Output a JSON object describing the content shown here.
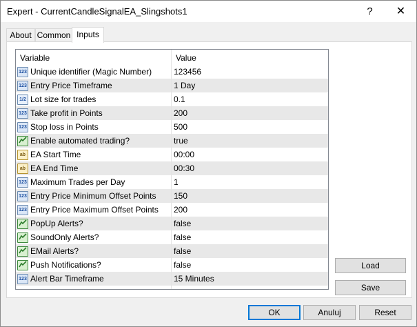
{
  "window": {
    "title": "Expert - CurrentCandleSignalEA_Slingshots1",
    "help_label": "?",
    "close_label": "✕"
  },
  "tabs": [
    {
      "label": "About"
    },
    {
      "label": "Common"
    },
    {
      "label": "Inputs",
      "active": true
    }
  ],
  "grid": {
    "columns": [
      "Variable",
      "Value"
    ],
    "rows": [
      {
        "icon": "int-type-icon",
        "badge": "123",
        "variable": "Unique identifier (Magic Number)",
        "value": "123456"
      },
      {
        "icon": "int-type-icon",
        "badge": "123",
        "variable": "Entry Price Timeframe",
        "value": "1 Day"
      },
      {
        "icon": "double-type-icon",
        "badge": "1/2",
        "variable": "Lot size for trades",
        "value": "0.1"
      },
      {
        "icon": "int-type-icon",
        "badge": "123",
        "variable": "Take profit in Points",
        "value": "200"
      },
      {
        "icon": "int-type-icon",
        "badge": "123",
        "variable": "Stop loss in Points",
        "value": "500"
      },
      {
        "icon": "bool-type-icon",
        "badge": "",
        "variable": "Enable automated trading?",
        "value": "true"
      },
      {
        "icon": "string-type-icon",
        "badge": "ab",
        "variable": "EA Start Time",
        "value": "00:00"
      },
      {
        "icon": "string-type-icon",
        "badge": "ab",
        "variable": "EA End Time",
        "value": "00:30"
      },
      {
        "icon": "int-type-icon",
        "badge": "123",
        "variable": "Maximum Trades per Day",
        "value": "1"
      },
      {
        "icon": "int-type-icon",
        "badge": "123",
        "variable": "Entry Price Minimum Offset Points",
        "value": "150"
      },
      {
        "icon": "int-type-icon",
        "badge": "123",
        "variable": "Entry Price Maximum Offset Points",
        "value": "200"
      },
      {
        "icon": "bool-type-icon",
        "badge": "",
        "variable": "PopUp Alerts?",
        "value": "false"
      },
      {
        "icon": "bool-type-icon",
        "badge": "",
        "variable": "SoundOnly Alerts?",
        "value": "false"
      },
      {
        "icon": "bool-type-icon",
        "badge": "",
        "variable": "EMail Alerts?",
        "value": "false"
      },
      {
        "icon": "bool-type-icon",
        "badge": "",
        "variable": "Push Notifications?",
        "value": "false"
      },
      {
        "icon": "int-type-icon",
        "badge": "123",
        "variable": "Alert Bar Timeframe",
        "value": "15 Minutes"
      }
    ]
  },
  "side_buttons": {
    "load": "Load",
    "save": "Save"
  },
  "bottom_buttons": {
    "ok": "OK",
    "cancel": "Anuluj",
    "reset": "Reset"
  }
}
